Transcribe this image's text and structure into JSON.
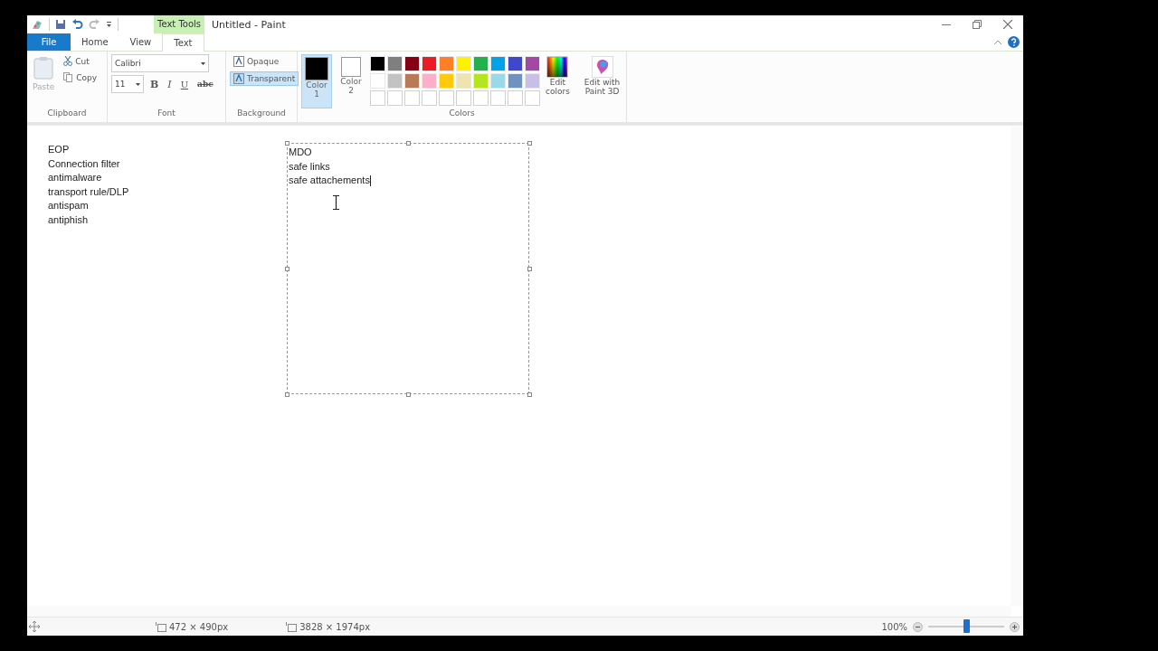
{
  "window": {
    "title": "Untitled - Paint",
    "context_label": "Text Tools"
  },
  "tabs": [
    {
      "label": "File",
      "kind": "file",
      "selected": false
    },
    {
      "label": "Home",
      "kind": "tab",
      "selected": false
    },
    {
      "label": "View",
      "kind": "tab",
      "selected": false
    },
    {
      "label": "Text",
      "kind": "tab",
      "selected": true
    }
  ],
  "clipboard": {
    "label": "Clipboard",
    "paste": {
      "label": "Paste",
      "disabled": true
    },
    "cut": "Cut",
    "copy": "Copy"
  },
  "font": {
    "label": "Font",
    "family": "Calibri",
    "size": "11",
    "styles": [
      {
        "label": "B",
        "kind": "bold"
      },
      {
        "label": "I",
        "kind": "italic"
      },
      {
        "label": "U",
        "kind": "underline"
      },
      {
        "label": "abc",
        "kind": "strike"
      }
    ]
  },
  "background": {
    "label": "Background",
    "options": [
      {
        "label": "Opaque",
        "selected": false
      },
      {
        "label": "Transparent",
        "selected": true
      }
    ]
  },
  "colors": {
    "label": "Colors",
    "slots": [
      {
        "label": "Color",
        "number": "1",
        "color": "#000000",
        "selected": true
      },
      {
        "label": "Color",
        "number": "2",
        "color": "#ffffff",
        "selected": false
      }
    ],
    "palette": [
      {
        "color": "#000000"
      },
      {
        "color": "#7f7f7f"
      },
      {
        "color": "#880015"
      },
      {
        "color": "#ed1c24"
      },
      {
        "color": "#ff7f27"
      },
      {
        "color": "#fff200"
      },
      {
        "color": "#22b14c"
      },
      {
        "color": "#00a2e8"
      },
      {
        "color": "#3f48cc"
      },
      {
        "color": "#a349a4"
      },
      {
        "color": "#ffffff"
      },
      {
        "color": "#c3c3c3"
      },
      {
        "color": "#b97a57"
      },
      {
        "color": "#ffaec9"
      },
      {
        "color": "#ffc90e"
      },
      {
        "color": "#efe4b0"
      },
      {
        "color": "#b5e61d"
      },
      {
        "color": "#99d9ea"
      },
      {
        "color": "#7092be"
      },
      {
        "color": "#c8bfe7"
      },
      {
        "kind": "empty"
      },
      {
        "kind": "empty"
      },
      {
        "kind": "empty"
      },
      {
        "kind": "empty"
      },
      {
        "kind": "empty"
      },
      {
        "kind": "empty"
      },
      {
        "kind": "empty"
      },
      {
        "kind": "empty"
      },
      {
        "kind": "empty"
      },
      {
        "kind": "empty"
      }
    ],
    "edit_colors": [
      "Edit",
      "colors"
    ],
    "paint3d": [
      "Edit with",
      "Paint 3D"
    ]
  },
  "canvas": {
    "blocks": [
      {
        "kind": "text",
        "lines": [
          "EOP",
          "Connection filter",
          "antimalware",
          "transport rule/DLP",
          "antispam",
          "antiphish"
        ]
      },
      {
        "kind": "textbox",
        "lines": [
          "MDO",
          "safe links",
          "safe attachements"
        ]
      }
    ]
  },
  "status_bar": {
    "selection_size": "472 × 490px",
    "canvas_size": "3828 × 1974px",
    "zoom": "100%",
    "zoom_slider": {
      "level": 0.5
    }
  }
}
